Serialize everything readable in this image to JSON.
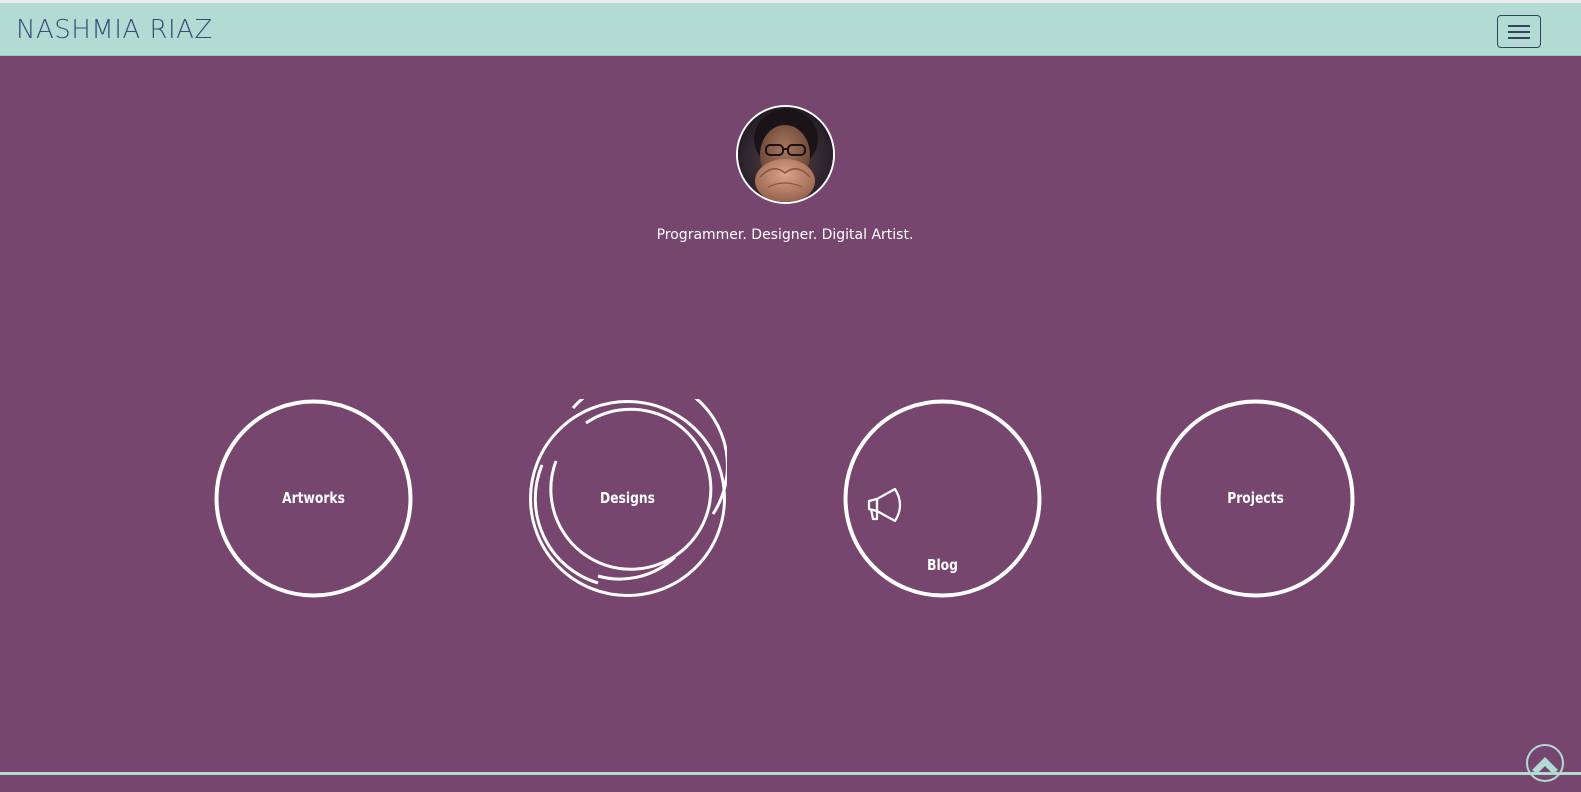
{
  "navbar": {
    "brand": "NASHMIA RIAZ",
    "menu_icon": "hamburger-menu-icon"
  },
  "profile": {
    "tagline": "Programmer. Designer. Digital Artist."
  },
  "sections": [
    {
      "label": "Artworks",
      "icon": "circle-ring"
    },
    {
      "label": "Designs",
      "icon": "concentric-arcs"
    },
    {
      "label": "Blog",
      "icon": "megaphone-icon"
    },
    {
      "label": "Projects",
      "icon": "circle-ring"
    }
  ],
  "scroll_top": {
    "icon": "chevron-up-icon"
  },
  "colors": {
    "navbar": "#b2dcd3",
    "brand_text": "#3a4a78",
    "hero_background": "#77466f",
    "foreground": "#ffffff"
  }
}
